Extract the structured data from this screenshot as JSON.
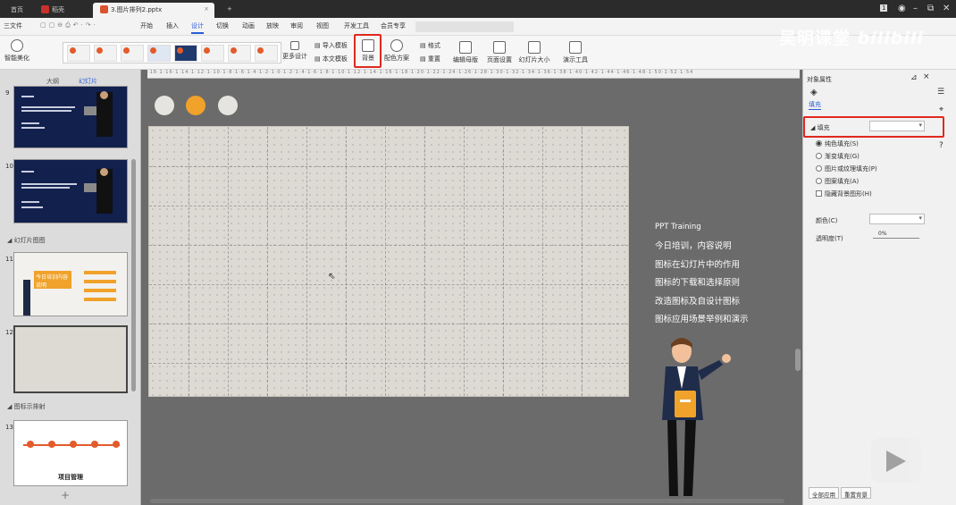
{
  "titlebar": {
    "tab_home": "首页",
    "tab_store": "稻壳",
    "tab_file": "3.图片排列2.pptx",
    "tab_add": "+"
  },
  "menubar": {
    "file": "三文件",
    "items": [
      "开始",
      "插入",
      "设计",
      "切换",
      "动画",
      "放映",
      "审阅",
      "视图",
      "开发工具",
      "会员专享"
    ],
    "active": "设计"
  },
  "ribbon": {
    "smart": "智能美化",
    "more_design": "更多设计",
    "import_template": "导入模板",
    "text_template": "本文模板",
    "background": "背景",
    "color_scheme": "配色方案",
    "format": "格式",
    "reset": "重置",
    "edit_master": "编辑母版",
    "page_setup": "页面设置",
    "slide_size": "幻灯片大小",
    "presentation_tools": "演示工具"
  },
  "watermark": {
    "channel": "吴明课堂",
    "site": "bilibili"
  },
  "left": {
    "tab_outline": "大纲",
    "tab_slides": "幻灯片",
    "section_label": "幻灯片图图",
    "section_label2": "图标示排射",
    "slide_nums": [
      "9",
      "10",
      "11",
      "12",
      "13"
    ],
    "slide13_title": "项目管理",
    "slide11_title": "今日培训内容说明",
    "add": "+"
  },
  "notes": {
    "title": "PPT Training",
    "lines": [
      "今日培训，内容说明",
      "图标在幻灯片中的作用",
      "图标的下载和选择原则",
      "改造图标及自设计图标",
      "图标应用场景举例和演示"
    ]
  },
  "colors": {
    "dot1": "#e6e4e0",
    "dot2": "#f0a22a",
    "dot3": "#e6e4e0",
    "accent": "#e0281e"
  },
  "right": {
    "panel_title": "对象属性",
    "tab": "填充",
    "fill_header": "填充",
    "options": [
      "纯色填充(S)",
      "渐变填充(G)",
      "图片或纹理填充(P)",
      "图案填充(A)"
    ],
    "hide_bg": "隐藏背景图形(H)",
    "color_label": "颜色(C)",
    "transparency_label": "透明度(T)",
    "transparency_value": "0%",
    "apply_all": "全部应用",
    "reset_bg": "重置背景"
  }
}
